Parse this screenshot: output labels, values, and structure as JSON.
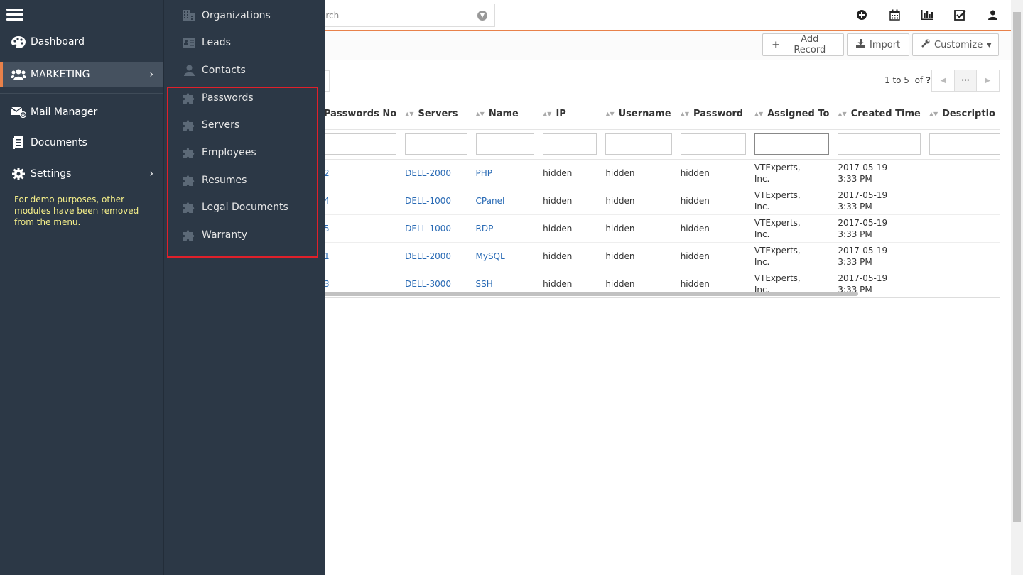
{
  "search": {
    "placeholder": "arch"
  },
  "toolbar": {
    "add_record": "Add Record",
    "import": "Import",
    "customize": "Customize"
  },
  "pager": {
    "range": "1 to 5",
    "of": "of",
    "total": "?"
  },
  "table": {
    "columns": [
      "Passwords No",
      "Servers",
      "Name",
      "IP",
      "Username",
      "Password",
      "Assigned To",
      "Created Time",
      "Descriptio"
    ],
    "rows": [
      {
        "no": "2",
        "server": "DELL-2000",
        "name": "PHP",
        "ip": "hidden",
        "user": "hidden",
        "pass": "hidden",
        "assigned1": "VTExperts,",
        "assigned2": "Inc.",
        "created1": "2017-05-19",
        "created2": "3:33 PM"
      },
      {
        "no": "4",
        "server": "DELL-1000",
        "name": "CPanel",
        "ip": "hidden",
        "user": "hidden",
        "pass": "hidden",
        "assigned1": "VTExperts,",
        "assigned2": "Inc.",
        "created1": "2017-05-19",
        "created2": "3:33 PM"
      },
      {
        "no": "5",
        "server": "DELL-1000",
        "name": "RDP",
        "ip": "hidden",
        "user": "hidden",
        "pass": "hidden",
        "assigned1": "VTExperts,",
        "assigned2": "Inc.",
        "created1": "2017-05-19",
        "created2": "3:33 PM"
      },
      {
        "no": "1",
        "server": "DELL-2000",
        "name": "MySQL",
        "ip": "hidden",
        "user": "hidden",
        "pass": "hidden",
        "assigned1": "VTExperts,",
        "assigned2": "Inc.",
        "created1": "2017-05-19",
        "created2": "3:33 PM"
      },
      {
        "no": "3",
        "server": "DELL-3000",
        "name": "SSH",
        "ip": "hidden",
        "user": "hidden",
        "pass": "hidden",
        "assigned1": "VTExperts,",
        "assigned2": "Inc.",
        "created1": "2017-05-19",
        "created2": "3:33 PM"
      }
    ]
  },
  "sidebar": {
    "items": [
      {
        "label": "Dashboard",
        "icon": "palette-icon"
      },
      {
        "label": "MARKETING",
        "icon": "users-icon"
      },
      {
        "label": "Mail Manager",
        "icon": "mail-icon"
      },
      {
        "label": "Documents",
        "icon": "document-icon"
      },
      {
        "label": "Settings",
        "icon": "gear-icon"
      }
    ],
    "note": "For demo purposes, other modules have been removed from the menu."
  },
  "submenu": {
    "items": [
      {
        "label": "Organizations",
        "icon": "building-icon"
      },
      {
        "label": "Leads",
        "icon": "id-card-icon"
      },
      {
        "label": "Contacts",
        "icon": "user-icon"
      },
      {
        "label": "Passwords",
        "icon": "puzzle-icon"
      },
      {
        "label": "Servers",
        "icon": "puzzle-icon"
      },
      {
        "label": "Employees",
        "icon": "puzzle-icon"
      },
      {
        "label": "Resumes",
        "icon": "puzzle-icon"
      },
      {
        "label": "Legal Documents",
        "icon": "puzzle-icon"
      },
      {
        "label": "Warranty",
        "icon": "puzzle-icon"
      }
    ]
  },
  "colors": {
    "sidebar_bg": "#2c3846",
    "accent": "#e8814a",
    "link": "#2a6bb5",
    "note": "#f6f08a",
    "highlight": "#e0202a"
  }
}
